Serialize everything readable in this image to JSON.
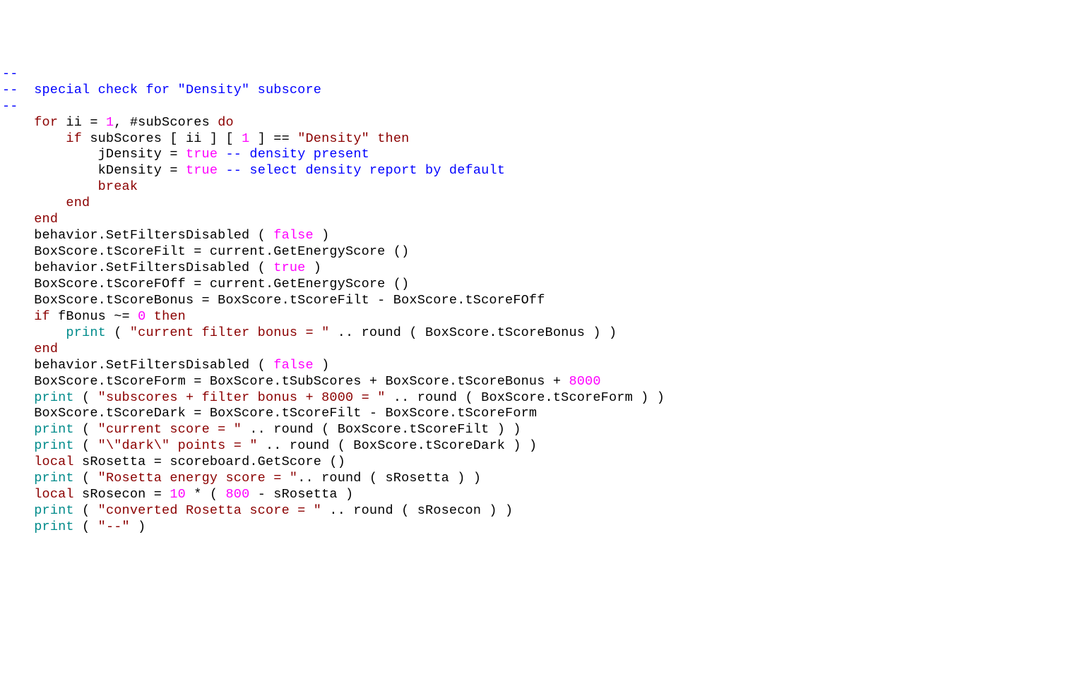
{
  "lines": [
    [
      {
        "cls": "c",
        "t": "--"
      }
    ],
    [
      {
        "cls": "c",
        "t": "--  special check for \"Density\" subscore"
      }
    ],
    [
      {
        "cls": "c",
        "t": "--"
      }
    ],
    [
      {
        "cls": "d",
        "t": "    "
      },
      {
        "cls": "k",
        "t": "for"
      },
      {
        "cls": "d",
        "t": " ii = "
      },
      {
        "cls": "n",
        "t": "1"
      },
      {
        "cls": "d",
        "t": ", #subScores "
      },
      {
        "cls": "k",
        "t": "do"
      }
    ],
    [
      {
        "cls": "d",
        "t": "        "
      },
      {
        "cls": "k",
        "t": "if"
      },
      {
        "cls": "d",
        "t": " subScores [ ii ] [ "
      },
      {
        "cls": "n",
        "t": "1"
      },
      {
        "cls": "d",
        "t": " ] == "
      },
      {
        "cls": "s",
        "t": "\"Density\""
      },
      {
        "cls": "d",
        "t": " "
      },
      {
        "cls": "k",
        "t": "then"
      }
    ],
    [
      {
        "cls": "d",
        "t": "            jDensity = "
      },
      {
        "cls": "n",
        "t": "true"
      },
      {
        "cls": "d",
        "t": " "
      },
      {
        "cls": "c",
        "t": "-- density present"
      }
    ],
    [
      {
        "cls": "d",
        "t": "            kDensity = "
      },
      {
        "cls": "n",
        "t": "true"
      },
      {
        "cls": "d",
        "t": " "
      },
      {
        "cls": "c",
        "t": "-- select density report by default"
      }
    ],
    [
      {
        "cls": "d",
        "t": "            "
      },
      {
        "cls": "k",
        "t": "break"
      }
    ],
    [
      {
        "cls": "d",
        "t": "        "
      },
      {
        "cls": "k",
        "t": "end"
      }
    ],
    [
      {
        "cls": "d",
        "t": "    "
      },
      {
        "cls": "k",
        "t": "end"
      }
    ],
    [
      {
        "cls": "d",
        "t": ""
      }
    ],
    [
      {
        "cls": "d",
        "t": "    behavior.SetFiltersDisabled ( "
      },
      {
        "cls": "n",
        "t": "false"
      },
      {
        "cls": "d",
        "t": " )"
      }
    ],
    [
      {
        "cls": "d",
        "t": "    BoxScore.tScoreFilt = current.GetEnergyScore ()"
      }
    ],
    [
      {
        "cls": "d",
        "t": "    behavior.SetFiltersDisabled ( "
      },
      {
        "cls": "n",
        "t": "true"
      },
      {
        "cls": "d",
        "t": " )"
      }
    ],
    [
      {
        "cls": "d",
        "t": "    BoxScore.tScoreFOff = current.GetEnergyScore ()"
      }
    ],
    [
      {
        "cls": "d",
        "t": "    BoxScore.tScoreBonus = BoxScore.tScoreFilt - BoxScore.tScoreFOff"
      }
    ],
    [
      {
        "cls": "d",
        "t": "    "
      },
      {
        "cls": "k",
        "t": "if"
      },
      {
        "cls": "d",
        "t": " fBonus ~= "
      },
      {
        "cls": "n",
        "t": "0"
      },
      {
        "cls": "d",
        "t": " "
      },
      {
        "cls": "k",
        "t": "then"
      }
    ],
    [
      {
        "cls": "d",
        "t": "        "
      },
      {
        "cls": "b",
        "t": "print"
      },
      {
        "cls": "d",
        "t": " ( "
      },
      {
        "cls": "s",
        "t": "\"current filter bonus = \""
      },
      {
        "cls": "d",
        "t": " .. round ( BoxScore.tScoreBonus ) )"
      }
    ],
    [
      {
        "cls": "d",
        "t": "    "
      },
      {
        "cls": "k",
        "t": "end"
      }
    ],
    [
      {
        "cls": "d",
        "t": "    behavior.SetFiltersDisabled ( "
      },
      {
        "cls": "n",
        "t": "false"
      },
      {
        "cls": "d",
        "t": " )"
      }
    ],
    [
      {
        "cls": "d",
        "t": "    BoxScore.tScoreForm = BoxScore.tSubScores + BoxScore.tScoreBonus + "
      },
      {
        "cls": "n",
        "t": "8000"
      }
    ],
    [
      {
        "cls": "d",
        "t": "    "
      },
      {
        "cls": "b",
        "t": "print"
      },
      {
        "cls": "d",
        "t": " ( "
      },
      {
        "cls": "s",
        "t": "\"subscores + filter bonus + 8000 = \""
      },
      {
        "cls": "d",
        "t": " .. round ( BoxScore.tScoreForm ) )"
      }
    ],
    [
      {
        "cls": "d",
        "t": "    BoxScore.tScoreDark = BoxScore.tScoreFilt - BoxScore.tScoreForm"
      }
    ],
    [
      {
        "cls": "d",
        "t": "    "
      },
      {
        "cls": "b",
        "t": "print"
      },
      {
        "cls": "d",
        "t": " ( "
      },
      {
        "cls": "s",
        "t": "\"current score = \""
      },
      {
        "cls": "d",
        "t": " .. round ( BoxScore.tScoreFilt ) )"
      }
    ],
    [
      {
        "cls": "d",
        "t": "    "
      },
      {
        "cls": "b",
        "t": "print"
      },
      {
        "cls": "d",
        "t": " ( "
      },
      {
        "cls": "s",
        "t": "\"\\\"dark\\\" points = \""
      },
      {
        "cls": "d",
        "t": " .. round ( BoxScore.tScoreDark ) )"
      }
    ],
    [
      {
        "cls": "d",
        "t": ""
      }
    ],
    [
      {
        "cls": "d",
        "t": "    "
      },
      {
        "cls": "k",
        "t": "local"
      },
      {
        "cls": "d",
        "t": " sRosetta = scoreboard.GetScore ()"
      }
    ],
    [
      {
        "cls": "d",
        "t": "    "
      },
      {
        "cls": "b",
        "t": "print"
      },
      {
        "cls": "d",
        "t": " ( "
      },
      {
        "cls": "s",
        "t": "\"Rosetta energy score = \""
      },
      {
        "cls": "d",
        "t": ".. round ( sRosetta ) )"
      }
    ],
    [
      {
        "cls": "d",
        "t": "    "
      },
      {
        "cls": "k",
        "t": "local"
      },
      {
        "cls": "d",
        "t": " sRosecon = "
      },
      {
        "cls": "n",
        "t": "10"
      },
      {
        "cls": "d",
        "t": " * ( "
      },
      {
        "cls": "n",
        "t": "800"
      },
      {
        "cls": "d",
        "t": " - sRosetta )"
      }
    ],
    [
      {
        "cls": "d",
        "t": "    "
      },
      {
        "cls": "b",
        "t": "print"
      },
      {
        "cls": "d",
        "t": " ( "
      },
      {
        "cls": "s",
        "t": "\"converted Rosetta score = \""
      },
      {
        "cls": "d",
        "t": " .. round ( sRosecon ) )"
      }
    ],
    [
      {
        "cls": "d",
        "t": "    "
      },
      {
        "cls": "b",
        "t": "print"
      },
      {
        "cls": "d",
        "t": " ( "
      },
      {
        "cls": "s",
        "t": "\"--\""
      },
      {
        "cls": "d",
        "t": " )"
      }
    ]
  ]
}
